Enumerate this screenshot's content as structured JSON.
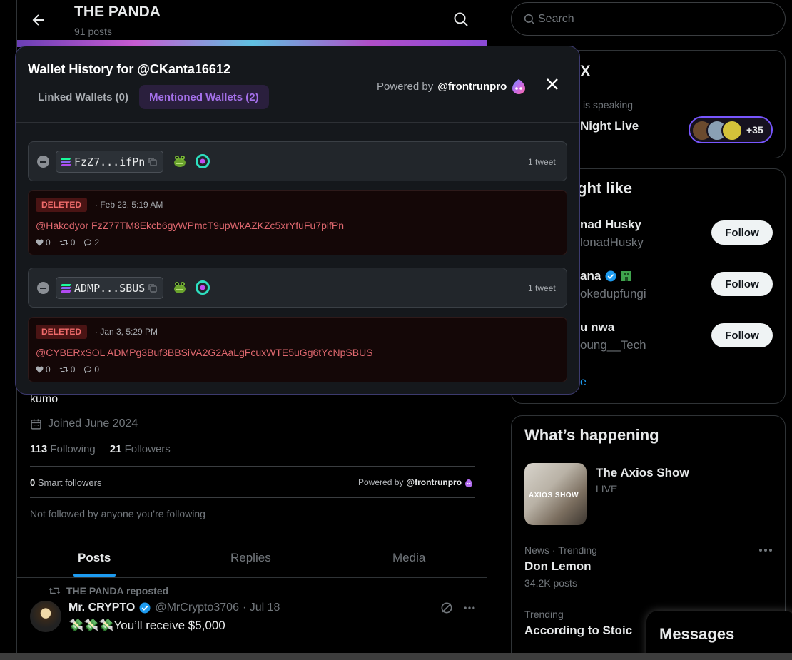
{
  "profile": {
    "name": "THE PANDA",
    "posts_count": "91 posts",
    "bio": "kumo",
    "joined": "Joined June 2024",
    "following_count": "113",
    "following_label": "Following",
    "followers_count": "21",
    "followers_label": "Followers",
    "smart_count": "0",
    "smart_label": "Smart followers",
    "powered_label": "Powered by",
    "powered_handle": "@frontrunpro",
    "not_followed": "Not followed by anyone you’re following"
  },
  "tabs": [
    "Posts",
    "Replies",
    "Media"
  ],
  "post": {
    "repost_label": "THE PANDA reposted",
    "author": "Mr. CRYPTO",
    "handle": "@MrCrypto3706",
    "date": "· Jul 18",
    "text": "💸💸💸You’ll receive $5,000"
  },
  "modal": {
    "title": "Wallet History for @CKanta16612",
    "tab_linked": "Linked Wallets (0)",
    "tab_mentioned": "Mentioned Wallets (2)",
    "powered_label": "Powered by",
    "powered_handle": "@frontrunpro",
    "wallets": [
      {
        "address": "FzZ7...ifPn",
        "tweet_count": "1 tweet",
        "status": "DELETED",
        "date": "· Feb 23, 5:19 AM",
        "text": "@Hakodyor FzZ77TM8Ekcb6gyWPmcT9upWkAZKZc5xrYfuFu7pifPn",
        "likes": "0",
        "retweets": "0",
        "replies": "2"
      },
      {
        "address": "ADMP...SBUS",
        "tweet_count": "1 tweet",
        "status": "DELETED",
        "date": "· Jan 3, 5:29 PM",
        "text": "@CYBERxSOL ADMPg3Buf3BBSiVA2G2AaLgFcuxWTE5uGg6tYcNpSBUS",
        "likes": "0",
        "retweets": "0",
        "replies": "0"
      }
    ]
  },
  "search": {
    "placeholder": "Search"
  },
  "spaces": {
    "title_visible": "X",
    "speaking": "is speaking",
    "show": "Night Live",
    "count": "+35"
  },
  "who_to_follow": {
    "title_visible": "ght like",
    "users": [
      {
        "name": "nad Husky",
        "handle": "lonadHusky",
        "button": "Follow"
      },
      {
        "name": "ana",
        "handle": "okedupfungi",
        "button": "Follow"
      },
      {
        "name": "u nwa",
        "handle": "oung__Tech",
        "button": "Follow"
      }
    ],
    "show_more": "e"
  },
  "happening": {
    "title": "What’s happening",
    "live_title": "The Axios Show",
    "live_status": "LIVE",
    "live_image_text": "AXIOS SHOW",
    "trends": [
      {
        "context": "News · Trending",
        "name": "Don Lemon",
        "posts": "34.2K posts"
      },
      {
        "context": "Trending",
        "name": "According to Stoic",
        "posts": ""
      }
    ]
  },
  "messages": {
    "label": "Messages"
  },
  "colors": {
    "accent": "#1d9bf0",
    "frontrun_purple": "#a470e9",
    "deleted_red": "#e0686f"
  }
}
